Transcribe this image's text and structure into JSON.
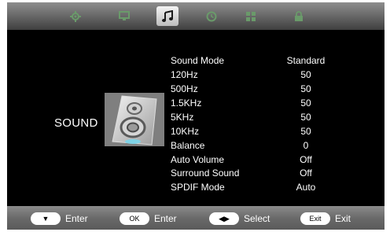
{
  "tabs": [
    {
      "icon": "picture-gear-icon",
      "active": false
    },
    {
      "icon": "monitor-icon",
      "active": false
    },
    {
      "icon": "music-note-icon",
      "active": true
    },
    {
      "icon": "clock-icon",
      "active": false
    },
    {
      "icon": "grid-icon",
      "active": false
    },
    {
      "icon": "lock-icon",
      "active": false
    }
  ],
  "section": {
    "title": "SOUND",
    "icon": "speaker-icon"
  },
  "menu": {
    "items": [
      {
        "label": "Sound Mode",
        "value": "Standard"
      },
      {
        "label": "120Hz",
        "value": "50"
      },
      {
        "label": "500Hz",
        "value": "50"
      },
      {
        "label": "1.5KHz",
        "value": "50"
      },
      {
        "label": "5KHz",
        "value": "50"
      },
      {
        "label": "10KHz",
        "value": "50"
      },
      {
        "label": "Balance",
        "value": "0"
      },
      {
        "label": "Auto Volume",
        "value": "Off"
      },
      {
        "label": "Surround Sound",
        "value": "Off"
      },
      {
        "label": "SPDIF Mode",
        "value": "Auto"
      }
    ]
  },
  "footer": {
    "hints": [
      {
        "key": "▼",
        "label": "Enter"
      },
      {
        "key": "OK",
        "label": "Enter"
      },
      {
        "key": "◀▶",
        "label": "Select"
      },
      {
        "key": "Exit",
        "label": "Exit"
      }
    ]
  },
  "colors": {
    "background": "#000000",
    "text": "#ffffff",
    "bar": "#7a7a7a"
  }
}
